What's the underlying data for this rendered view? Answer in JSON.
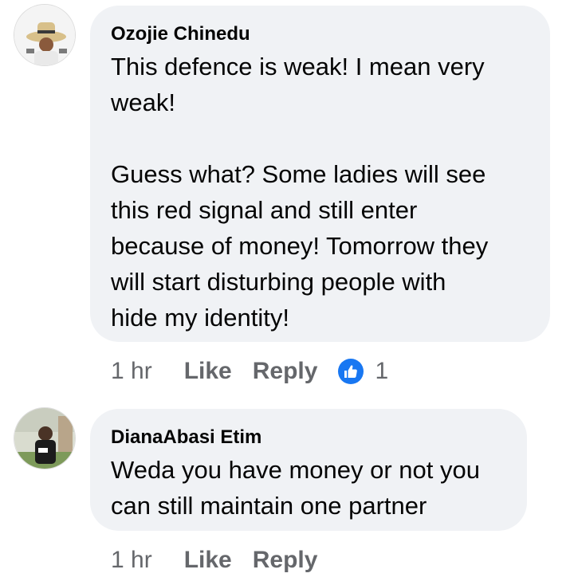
{
  "comments": [
    {
      "author": "Ozojie Chinedu",
      "paragraphs": [
        [
          "This defence is weak! I mean very",
          "weak!"
        ],
        [
          "Guess what? Some ladies will see",
          "this red signal and still enter",
          "because of money! Tomorrow they",
          "will start disturbing people with",
          "hide my identity!"
        ]
      ],
      "time": "1 hr",
      "like_label": "Like",
      "reply_label": "Reply",
      "reaction_icon": "thumbs-up-icon",
      "reaction_count": "1"
    },
    {
      "author": "DianaAbasi Etim",
      "paragraphs": [
        [
          "Weda you have money or not you",
          "can still maintain one partner"
        ]
      ],
      "time": "1 hr",
      "like_label": "Like",
      "reply_label": "Reply"
    }
  ],
  "colors": {
    "bubble": "#f0f2f5",
    "meta_text": "#65676b",
    "like_blue": "#1877f2"
  }
}
